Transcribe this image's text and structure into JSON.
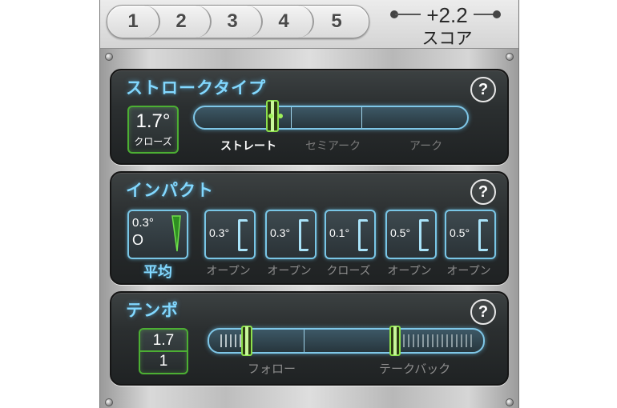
{
  "header": {
    "rounds": [
      "1",
      "2",
      "3",
      "4",
      "5"
    ],
    "score_value": "+2.2",
    "score_label": "スコア"
  },
  "stroke_type": {
    "title": "ストロークタイプ",
    "help": "?",
    "value": "1.7°",
    "value_label": "クローズ",
    "labels": [
      "ストレート",
      "セミアーク",
      "アーク"
    ],
    "selected": "ストレート"
  },
  "impact": {
    "title": "インパクト",
    "help": "?",
    "average_value": "0.3°",
    "average_symbol": "O",
    "average_label": "平均",
    "shots": [
      {
        "value": "0.3°",
        "label": "オープン"
      },
      {
        "value": "0.3°",
        "label": "オープン"
      },
      {
        "value": "0.1°",
        "label": "クローズ"
      },
      {
        "value": "0.5°",
        "label": "オープン"
      },
      {
        "value": "0.5°",
        "label": "オープン"
      }
    ]
  },
  "tempo": {
    "title": "テンポ",
    "help": "?",
    "ratio_top": "1.7",
    "ratio_bottom": "1",
    "follow_label": "フォロー",
    "backswing_label": "テークバック"
  },
  "colors": {
    "accent_blue": "#82d8ff",
    "accent_green": "#4caf33",
    "panel_bg": "#2b2f30"
  }
}
